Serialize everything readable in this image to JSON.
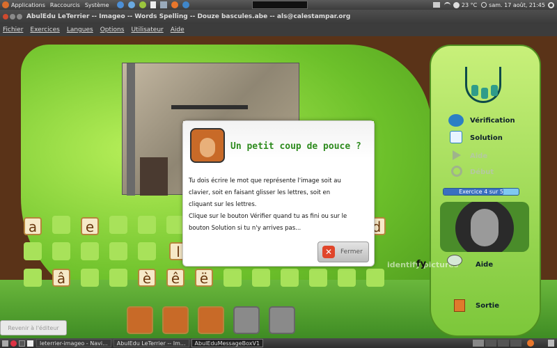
{
  "top_panel": {
    "menus": [
      "Applications",
      "Raccourcis",
      "Système"
    ],
    "temperature": "23 °C",
    "datetime": "sam. 17 août, 21:45"
  },
  "window": {
    "title": "AbulEdu LeTerrier -- Imageo -- Words Spelling -- Douze bascules.abe -- als@calestampar.org"
  },
  "menubar": {
    "items": [
      "Fichier",
      "Exercices",
      "Langues",
      "Options",
      "Utilisateur",
      "Aide"
    ]
  },
  "side_panel": {
    "verification": "Vérification",
    "solution": "Solution",
    "aide_disabled": "Aide",
    "debut": "Début",
    "progress_label": "Exercice 4 sur 5",
    "aide": "Aide",
    "sortie": "Sortie"
  },
  "board": {
    "row1": [
      "a",
      "",
      "e",
      "",
      "",
      "",
      "",
      "",
      "",
      "",
      "",
      "",
      "",
      "",
      "d"
    ],
    "row2": [
      "",
      "",
      "",
      "",
      "",
      "l",
      "",
      "",
      "",
      "",
      "",
      "",
      "",
      "",
      ""
    ],
    "row3": [
      "",
      "â",
      "",
      "",
      "è",
      "ê",
      "ë",
      "",
      "",
      "",
      "",
      "",
      "",
      "",
      ""
    ],
    "identify_text": "identify pictures",
    "fy_text": "fy"
  },
  "editor_button": "Revenir à l'éditeur",
  "dialog": {
    "title": "Un petit coup de pouce ?",
    "line1": "Tu dois écrire le mot que représente l'image soit au",
    "line2": "clavier, soit en faisant glisser les lettres, soit en",
    "line3": "cliquant sur les lettres.",
    "line4": "Clique sur le bouton Vérifier quand tu as fini ou sur le",
    "line5": "bouton Solution si tu n'y arrives pas...",
    "close_label": "Fermer"
  },
  "taskbar": {
    "tasks": [
      "leterrier-imageo - Navi...",
      "AbulEdu LeTerrier -- Im...",
      "AbulEduMessageBoxV1"
    ]
  },
  "colors": {
    "green_panel": "#8cd23c",
    "brown_bg": "#5a3318",
    "title_green": "#2e8b1e",
    "progress_blue": "#3a6fc0"
  }
}
